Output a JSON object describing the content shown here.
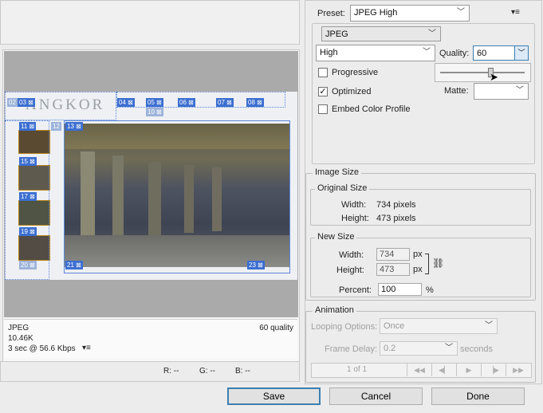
{
  "preset": {
    "label": "Preset:",
    "value": "JPEG High"
  },
  "format": {
    "value": "JPEG"
  },
  "quality_level": {
    "value": "High"
  },
  "quality": {
    "label": "Quality:",
    "value": "60",
    "slider_percent": 60
  },
  "progressive": {
    "label": "Progressive",
    "checked": false
  },
  "optimized": {
    "label": "Optimized",
    "checked": true,
    "mark": "✓"
  },
  "embed_profile": {
    "label": "Embed Color Profile",
    "checked": false
  },
  "matte": {
    "label": "Matte:",
    "value": ""
  },
  "image_size": {
    "title": "Image Size",
    "original": {
      "title": "Original Size",
      "width_label": "Width:",
      "width_value": "734 pixels",
      "height_label": "Height:",
      "height_value": "473 pixels"
    },
    "new": {
      "title": "New Size",
      "width_label": "Width:",
      "width_value": "734",
      "height_label": "Height:",
      "height_value": "473",
      "unit": "px"
    },
    "percent_label": "Percent:",
    "percent_value": "100",
    "percent_unit": "%"
  },
  "animation": {
    "title": "Animation",
    "looping_label": "Looping Options:",
    "looping_value": "Once",
    "delay_label": "Frame Delay:",
    "delay_value": "0.2",
    "delay_unit": "seconds",
    "frame_counter": "1 of 1"
  },
  "preview": {
    "title_text": "ANGKOR",
    "slices_top": [
      "03",
      "04",
      "05",
      "06",
      "07",
      "08"
    ],
    "slices_left": [
      "11",
      "15",
      "17",
      "19"
    ],
    "slice_labels_other": [
      "02",
      "09",
      "10",
      "12",
      "13",
      "20",
      "21",
      "23"
    ],
    "info": {
      "format": "JPEG",
      "size": "10.46K",
      "time": "3 sec @ 56.6 Kbps",
      "quality": "60 quality"
    }
  },
  "readouts": {
    "r": "R: --",
    "g": "G: --",
    "b": "B: --"
  },
  "buttons": {
    "save": "Save",
    "cancel": "Cancel",
    "done": "Done"
  },
  "colors": {
    "accent": "#3b6ed0",
    "slice_border": "#4f7fd9",
    "primary_border": "#3c7fb1"
  },
  "icons": [
    "menu-icon",
    "chain-link-icon",
    "first-frame-icon",
    "prev-frame-icon",
    "play-icon",
    "next-frame-icon",
    "last-frame-icon",
    "dropdown-chevron-icon",
    "slice-link-icon"
  ]
}
